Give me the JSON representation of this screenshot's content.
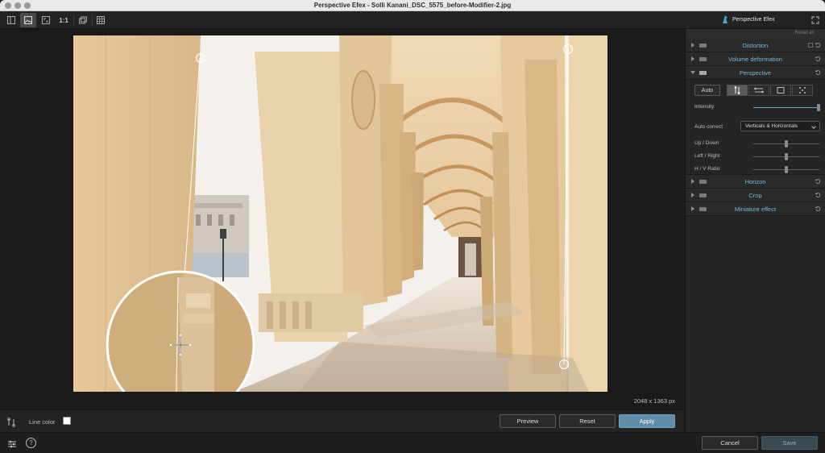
{
  "window": {
    "title": "Perspective Efex - Solli Kanani_DSC_5575_before-Modifier-2.jpg"
  },
  "toolbar": {
    "zoom_label": "1:1",
    "brand": "Perspective Efex",
    "icons": [
      "panel-toggle-icon",
      "image-view-icon",
      "fit-screen-icon",
      "zoom-1-1",
      "compare-icon",
      "grid-icon",
      "fullscreen-icon"
    ]
  },
  "canvas": {
    "image_dimensions": "2048 x 1363 px"
  },
  "actionbar": {
    "line_color_label": "Line color",
    "line_color": "#ffffff",
    "preview_label": "Preview",
    "reset_label": "Reset",
    "apply_label": "Apply"
  },
  "footer": {
    "cancel_label": "Cancel",
    "save_label": "Save"
  },
  "panel": {
    "reset_all_label": "Reset all",
    "sections": [
      {
        "title": "Distortion",
        "open": false
      },
      {
        "title": "Volume deformation",
        "open": false
      },
      {
        "title": "Perspective",
        "open": true
      },
      {
        "title": "Horizon",
        "open": false
      },
      {
        "title": "Crop",
        "open": false
      },
      {
        "title": "Miniature effect",
        "open": false
      }
    ],
    "perspective": {
      "auto_label": "Auto",
      "intensity_label": "Intensity",
      "intensity_value": 1.0,
      "auto_correct_label": "Auto correct",
      "auto_correct_value": "Verticals & Horizontals",
      "up_down_label": "Up / Down",
      "up_down_value": 0.5,
      "left_right_label": "Left / Right",
      "left_right_value": 0.5,
      "hv_ratio_label": "H / V Ratio",
      "hv_ratio_value": 0.5
    }
  },
  "colors": {
    "accent": "#75b9dc",
    "apply_button": "#5f8fa8",
    "panel_bg": "#252525",
    "canvas_bg": "#1a1a1a"
  }
}
